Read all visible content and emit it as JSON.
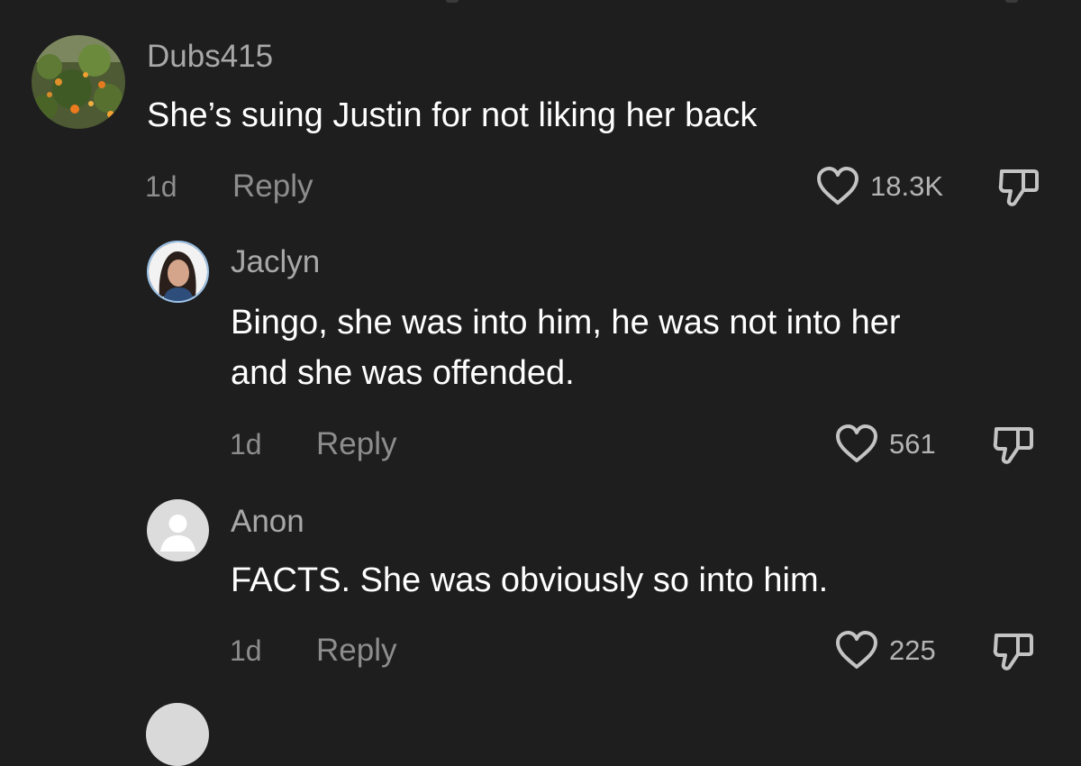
{
  "comments": [
    {
      "username": "Dubs415",
      "text": "She’s suing Justin for not liking her back",
      "time": "1d",
      "reply_label": "Reply",
      "likes": "18.3K"
    }
  ],
  "replies": [
    {
      "username": "Jaclyn",
      "text_lines": [
        "Bingo, she was into him, he was not into her",
        "and she was offended."
      ],
      "time": "1d",
      "reply_label": "Reply",
      "likes": "561"
    },
    {
      "username": "Anon",
      "text": "FACTS. She was obviously so into him.",
      "time": "1d",
      "reply_label": "Reply",
      "likes": "225"
    }
  ],
  "icons": {
    "like": "heart-outline-icon",
    "dislike": "thumbs-down-outline-icon",
    "default_avatar": "person-silhouette-icon"
  },
  "colors": {
    "background": "#1e1e1e",
    "text_primary": "#ffffff",
    "text_secondary": "#a8a8a8",
    "meta": "#8d8d8d"
  }
}
